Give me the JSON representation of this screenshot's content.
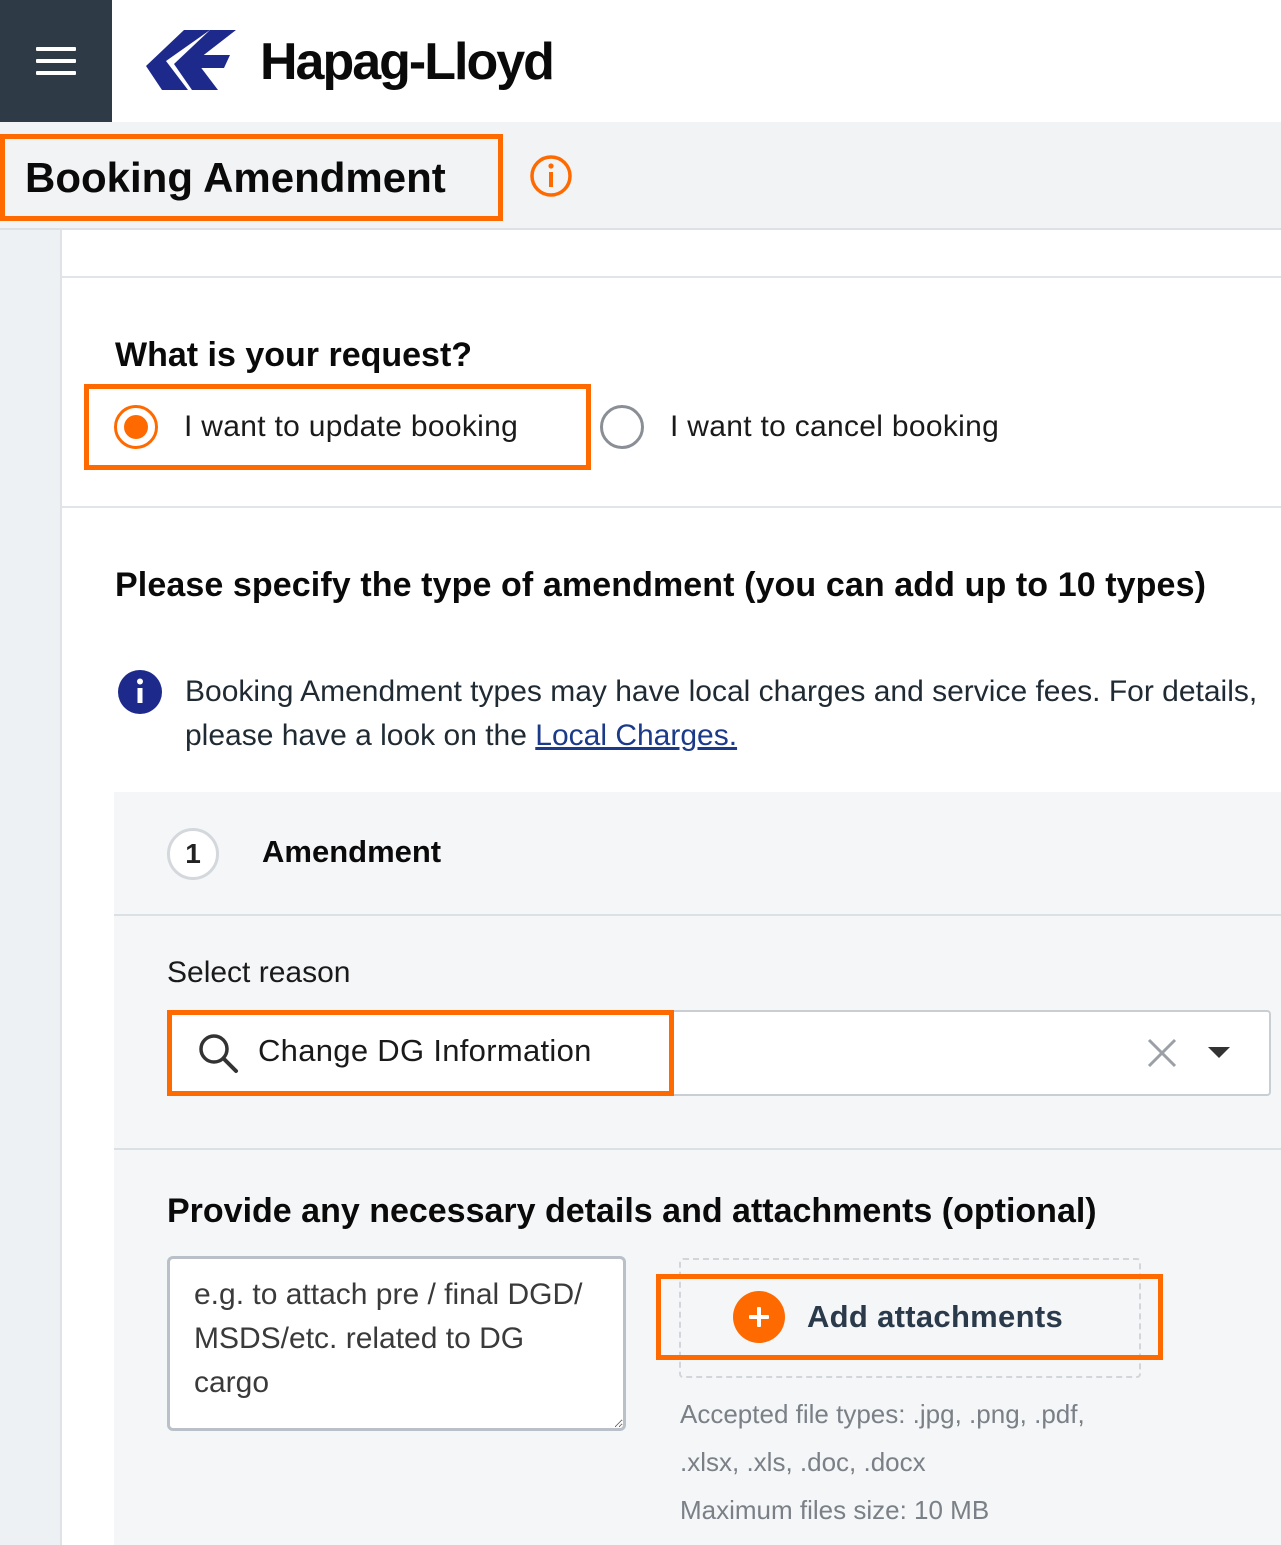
{
  "header": {
    "brand": "Hapag-Lloyd",
    "menu_icon": "hamburger-menu-icon",
    "logo_icon": "hapag-lloyd-logo-icon",
    "brand_color": "#ff6a00"
  },
  "page": {
    "title": "Booking Amendment",
    "title_info_icon": "info-circle-icon"
  },
  "request": {
    "question": "What is your request?",
    "options": [
      {
        "label": "I want to update booking",
        "selected": true
      },
      {
        "label": "I want to cancel booking",
        "selected": false
      }
    ]
  },
  "amendment_type": {
    "title": "Please specify the type of amendment (you can add up to 10 types)",
    "notice_prefix": "Booking Amendment types may have local charges and service fees. For details, please have a look on the ",
    "notice_link": "Local Charges.",
    "notice_icon": "info-filled-icon"
  },
  "amendment": {
    "step_number": "1",
    "step_title": "Amendment",
    "select_label": "Select reason",
    "select_value": "Change DG Information",
    "search_icon": "search-icon",
    "clear_icon": "close-icon",
    "caret_icon": "caret-down-icon"
  },
  "details": {
    "title": "Provide any necessary details and attachments (optional)",
    "placeholder": "e.g. to attach pre / final DGD/ MSDS/etc. related to DG cargo",
    "add_attachments_label": "Add attachments",
    "plus_icon": "plus-circle-icon",
    "accepted_types": "Accepted file types: .jpg, .png, .pdf, .xlsx, .xls, .doc, .docx",
    "max_size": "Maximum files size: 10 MB"
  },
  "colors": {
    "accent": "#ff6a00",
    "header_dark": "#2e3a46",
    "logo_blue": "#1d2a8c",
    "link_blue": "#1b3a8a"
  }
}
